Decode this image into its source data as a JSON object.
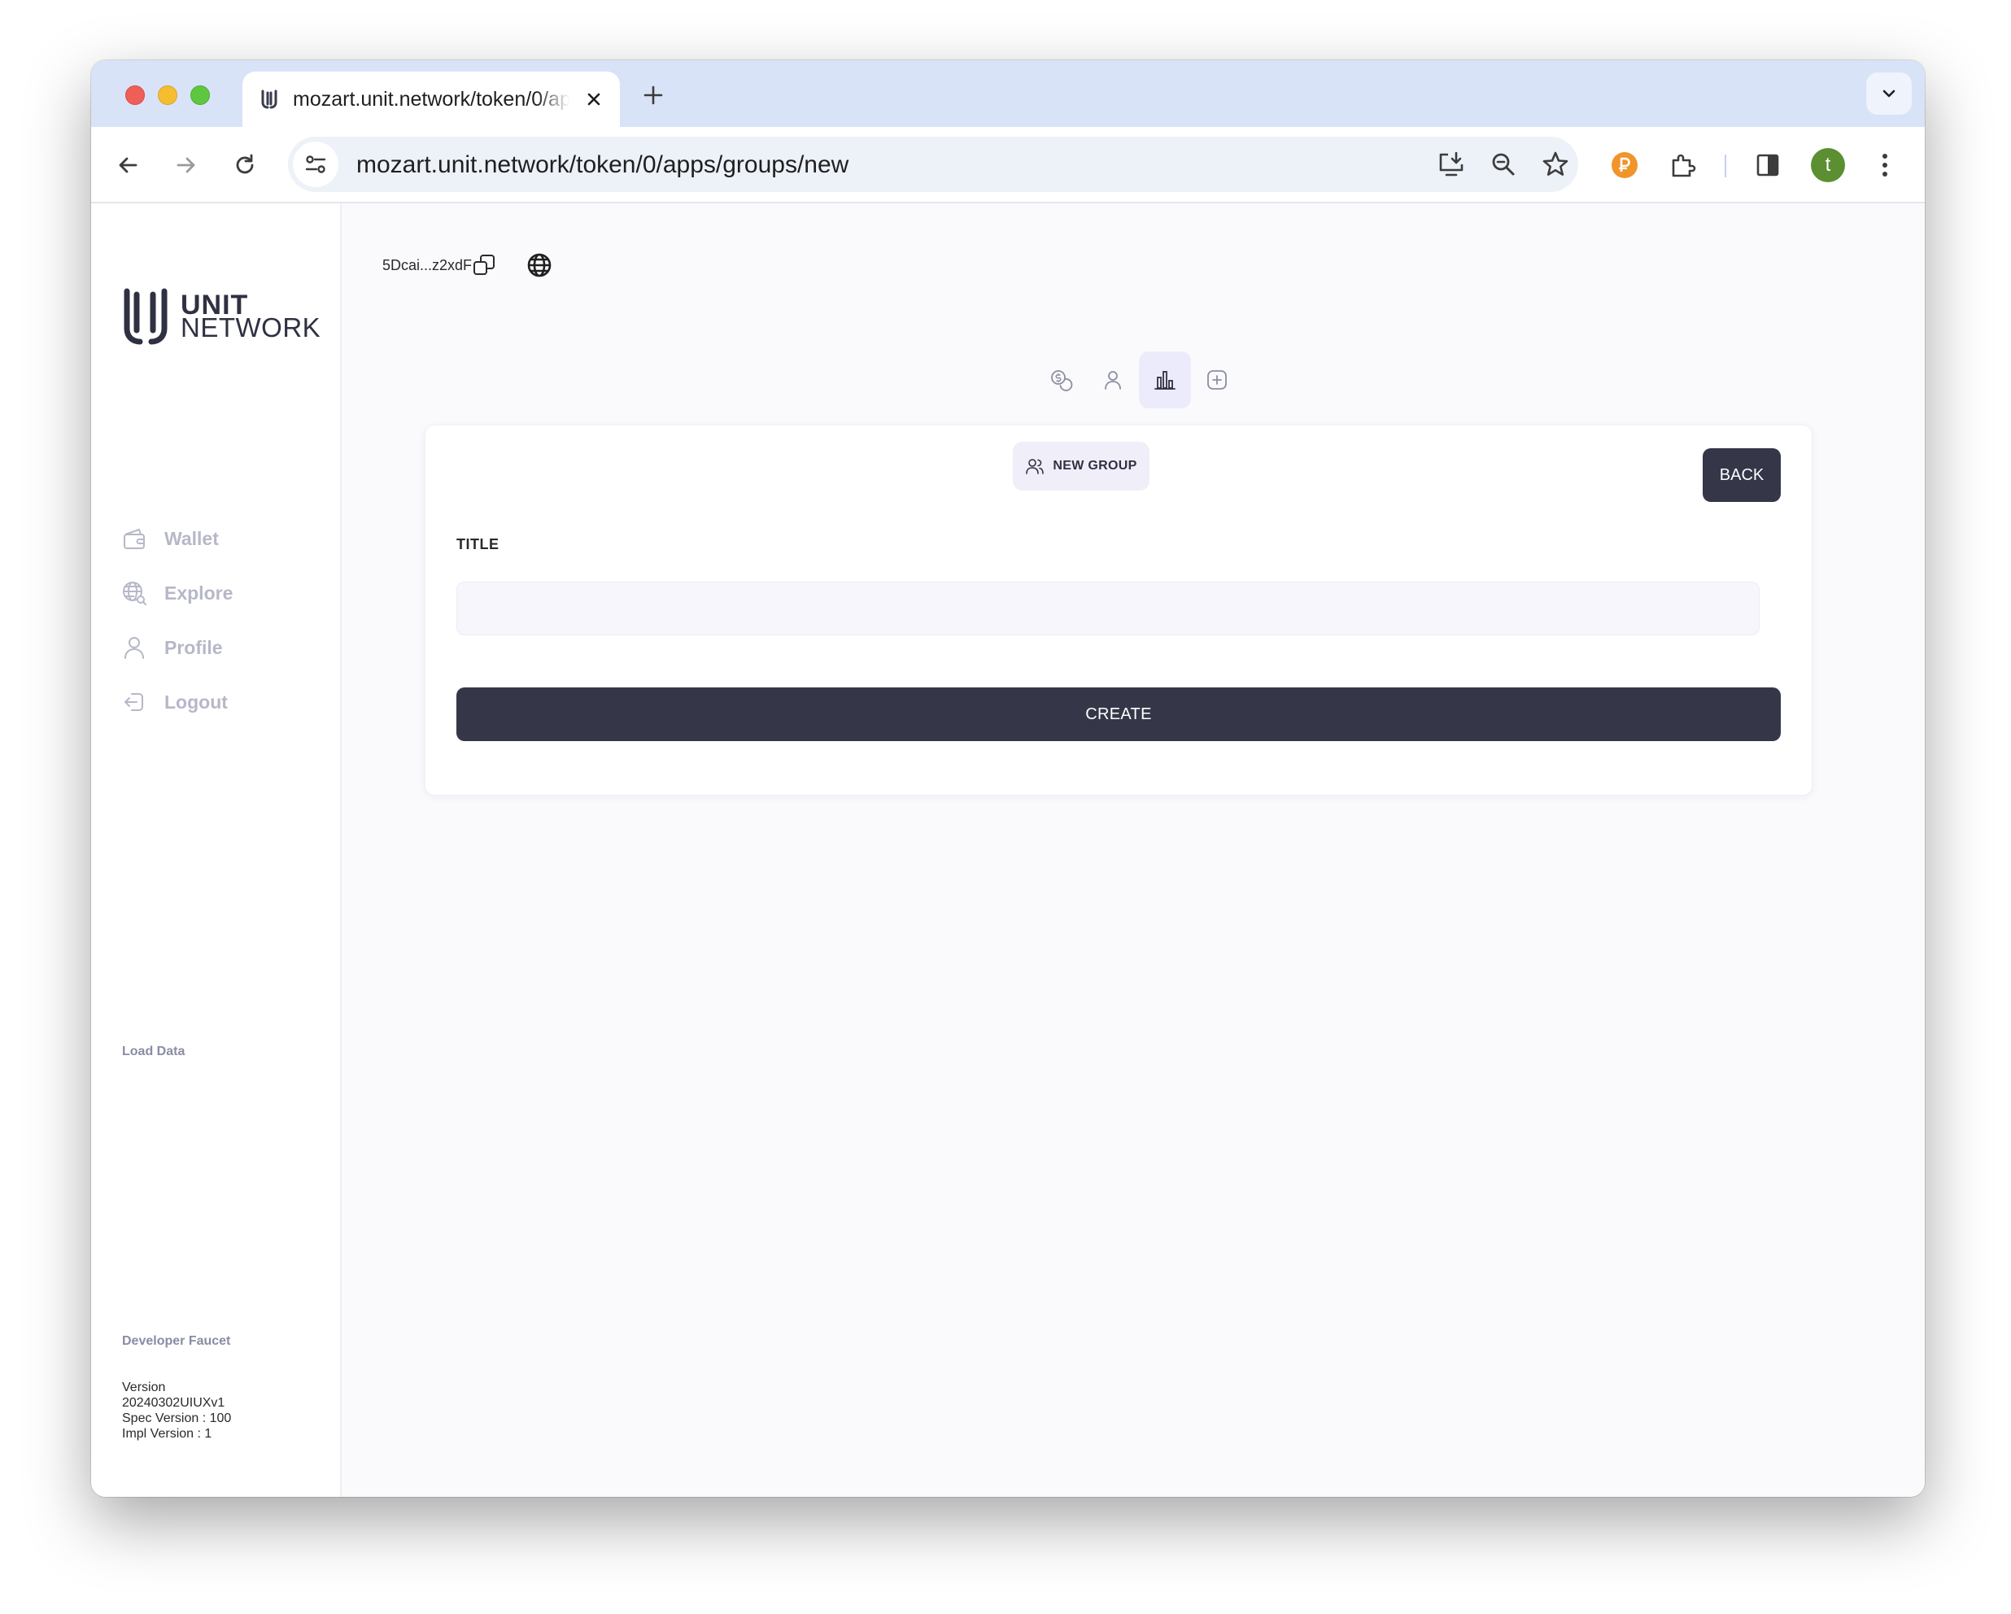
{
  "browser": {
    "tab_title": "mozart.unit.network/token/0/apps/groups/new",
    "url": "mozart.unit.network/token/0/apps/groups/new",
    "profile_initial": "t",
    "colors": {
      "tabstrip": "#d8e3f8",
      "omnibox": "#edf1f8",
      "avatar": "#5b8f31",
      "extension": "#f0952b"
    }
  },
  "sidebar": {
    "logo": {
      "line1": "UNIT",
      "line2": "NETWORK"
    },
    "nav": [
      {
        "label": "Wallet",
        "icon": "wallet-icon"
      },
      {
        "label": "Explore",
        "icon": "globe-search-icon"
      },
      {
        "label": "Profile",
        "icon": "user-icon"
      },
      {
        "label": "Logout",
        "icon": "logout-icon"
      }
    ],
    "load_data": "Load Data",
    "developer_faucet": "Developer Faucet",
    "version": {
      "label": "Version",
      "build": "20240302UIUXv1",
      "spec": "Spec Version : 100",
      "impl": "Impl Version : 1"
    }
  },
  "header": {
    "address": "5Dcai...z2xdF"
  },
  "apps_tabs": [
    {
      "icon": "coins-icon",
      "active": false
    },
    {
      "icon": "user-icon",
      "active": false
    },
    {
      "icon": "bar-chart-icon",
      "active": true
    },
    {
      "icon": "plus-square-icon",
      "active": false
    }
  ],
  "form": {
    "pill_label": "NEW GROUP",
    "back_label": "BACK",
    "title_label": "TITLE",
    "title_value": "",
    "create_label": "CREATE"
  },
  "colors": {
    "primary_button": "#353749",
    "pill_bg": "#efeef9",
    "nav_text": "#b6b8c8",
    "page_bg": "#fafafd"
  }
}
